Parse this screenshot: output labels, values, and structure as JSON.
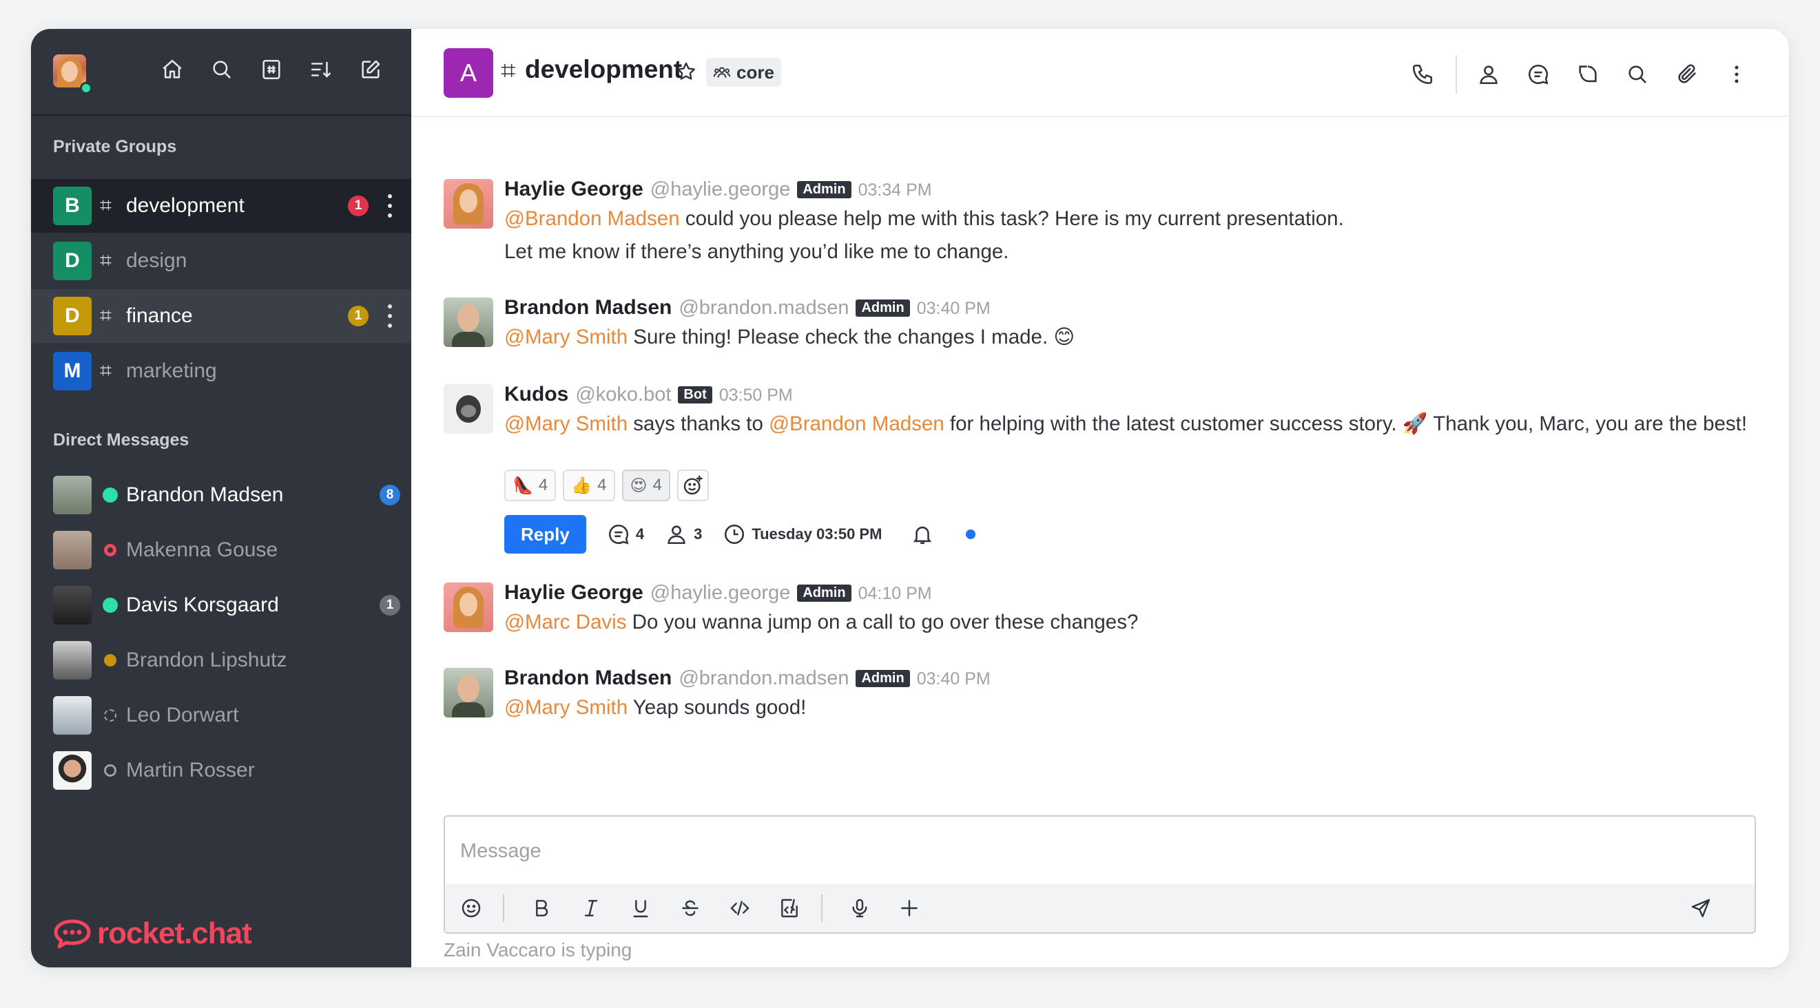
{
  "sidebar": {
    "private_groups_title": "Private Groups",
    "direct_messages_title": "Direct Messages",
    "groups": [
      {
        "letter": "B",
        "name": "development",
        "badge": "1",
        "badge_color": "#e0364d",
        "avatar_color": "#158d65"
      },
      {
        "letter": "D",
        "name": "design",
        "badge": "",
        "avatar_color": "#158d65"
      },
      {
        "letter": "D",
        "name": "finance",
        "badge": "1",
        "badge_color": "#c49a0a",
        "avatar_color": "#c49a0a"
      },
      {
        "letter": "M",
        "name": "marketing",
        "badge": "",
        "avatar_color": "#1560c9"
      }
    ],
    "dms": [
      {
        "name": "Brandon Madsen",
        "status": "online",
        "badge": "8",
        "badge_color": "#2f7dde"
      },
      {
        "name": "Makenna Gouse",
        "status": "busy",
        "badge": ""
      },
      {
        "name": "Davis Korsgaard",
        "status": "online",
        "badge": "1",
        "badge_color": "#6c727a"
      },
      {
        "name": "Brandon Lipshutz",
        "status": "away",
        "badge": ""
      },
      {
        "name": "Leo Dorwart",
        "status": "offline",
        "badge": ""
      },
      {
        "name": "Martin Rosser",
        "status": "offline",
        "badge": ""
      }
    ],
    "logo_text": "rocket.chat"
  },
  "header": {
    "avatar_letter": "A",
    "channel_name": "development",
    "tag": "core"
  },
  "messages": [
    {
      "name": "Haylie George",
      "handle": "@haylie.george",
      "role": "Admin",
      "time": "03:34 PM",
      "mention": "@Brandon Madsen",
      "text": " could you please help me with this task? Here is my current presentation.",
      "text2": "Let me know if there’s anything you’d like me to change."
    },
    {
      "name": "Brandon Madsen",
      "handle": "@brandon.madsen",
      "role": "Admin",
      "time": "03:40 PM",
      "mention": "@Mary Smith",
      "text": " Sure thing! Please check the changes I made. 😊"
    },
    {
      "name": "Kudos",
      "handle": "@koko.bot",
      "role": "Bot",
      "time": "03:50 PM",
      "mention": "@Mary Smith",
      "text_a": " says thanks to ",
      "mention2": "@Brandon Madsen",
      "text_b": " for helping with the latest customer success story. 🚀 Thank you, Marc, you are the best!",
      "reactions": [
        {
          "emoji": "👠",
          "count": "4"
        },
        {
          "emoji": "👍",
          "count": "4"
        },
        {
          "emoji": "😍",
          "count": "4"
        }
      ],
      "reply_label": "Reply",
      "thread_replies": "4",
      "thread_followers": "3",
      "thread_last": "Tuesday 03:50 PM"
    },
    {
      "name": "Haylie George",
      "handle": "@haylie.george",
      "role": "Admin",
      "time": "04:10 PM",
      "mention": "@Marc Davis",
      "text": " Do you wanna jump on a call to go over these changes?"
    },
    {
      "name": "Brandon Madsen",
      "handle": "@brandon.madsen",
      "role": "Admin",
      "time": "03:40 PM",
      "mention": "@Mary Smith",
      "text": " Yeap sounds good!"
    }
  ],
  "composer": {
    "placeholder": "Message",
    "typing": "Zain Vaccaro is typing"
  },
  "colors": {
    "mention": "#e8883b",
    "primary": "#1d74f5",
    "sidebar_bg": "#2f343d",
    "online": "#2de0a5",
    "busy": "#f5455c",
    "away": "#f3be08"
  }
}
